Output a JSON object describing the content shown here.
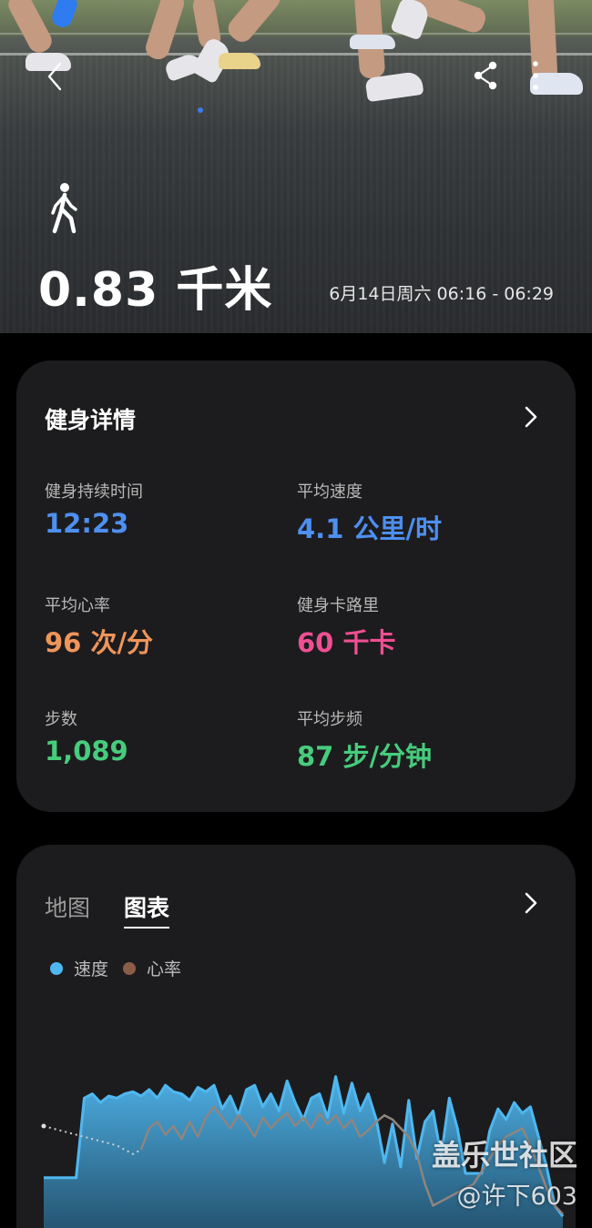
{
  "hero": {
    "distance": "0.83 千米",
    "datetime": "6月14日周六 06:16 - 06:29",
    "icons": [
      "back-icon",
      "share-icon",
      "more-icon",
      "walking-icon"
    ]
  },
  "details": {
    "title": "健身详情",
    "stats": [
      {
        "label": "健身持续时间",
        "value": "12:23",
        "color": "#4e8ff0"
      },
      {
        "label": "平均速度",
        "value": "4.1 公里/时",
        "color": "#4e8ff0"
      },
      {
        "label": "平均心率",
        "value": "96 次/分",
        "color": "#f0955a"
      },
      {
        "label": "健身卡路里",
        "value": "60 千卡",
        "color": "#ef4f92"
      },
      {
        "label": "步数",
        "value": "1,089",
        "color": "#47cc7c"
      },
      {
        "label": "平均步频",
        "value": "87 步/分钟",
        "color": "#47cc7c"
      }
    ]
  },
  "chart_section": {
    "tabs": [
      "地图",
      "图表"
    ],
    "selected_tab": "图表",
    "legend": [
      {
        "name": "速度",
        "color": "#4fb7ef"
      },
      {
        "name": "心率",
        "color": "#8b5d48"
      }
    ]
  },
  "chart_data": {
    "type": "area",
    "series": [
      {
        "name": "速度",
        "color": "#4fb7ef",
        "values": [
          2.3,
          2.3,
          2.3,
          2.3,
          2.3,
          6.0,
          6.2,
          5.8,
          6.1,
          6.0,
          6.2,
          6.3,
          6.1,
          6.4,
          6.0,
          6.6,
          6.3,
          6.2,
          5.9,
          6.5,
          6.3,
          6.6,
          5.5,
          6.1,
          5.2,
          6.4,
          6.6,
          5.6,
          6.2,
          5.4,
          6.8,
          5.8,
          5.0,
          6.0,
          6.2,
          5.1,
          7.0,
          5.3,
          6.7,
          5.4,
          6.2,
          5.0,
          3.0,
          4.8,
          2.8,
          5.9,
          3.2,
          4.9,
          5.4,
          3.3,
          6.0,
          4.6,
          2.5,
          2.5,
          2.5,
          4.5,
          5.5,
          5.0,
          5.8,
          5.3,
          5.6,
          4.2,
          2.8,
          1.0,
          0.5
        ],
        "values_note": ""
      },
      {
        "name": "心率",
        "color": "#8b5d48",
        "values": [
          4.7,
          4.6,
          4.5,
          4.4,
          4.3,
          4.2,
          4.1,
          4.0,
          3.9,
          3.8,
          3.6,
          3.4,
          3.6,
          4.6,
          4.9,
          4.3,
          4.7,
          4.1,
          4.9,
          4.2,
          5.1,
          5.6,
          5.1,
          4.6,
          5.2,
          4.8,
          4.2,
          5.1,
          4.6,
          5.0,
          5.3,
          4.7,
          5.1,
          4.6,
          5.3,
          4.8,
          5.2,
          4.6,
          5.0,
          4.2,
          4.5,
          4.9,
          5.2,
          5.0,
          4.6,
          4.2,
          3.4,
          2.0,
          1.0,
          1.2,
          1.4,
          1.6,
          1.8,
          2.0,
          2.6,
          3.2,
          3.8,
          4.2,
          4.4,
          4.6,
          3.8,
          2.8,
          1.8,
          1.0,
          0.6
        ]
      }
    ]
  },
  "watermark": {
    "line1": "盖乐世社区",
    "line2": "@许下603"
  }
}
